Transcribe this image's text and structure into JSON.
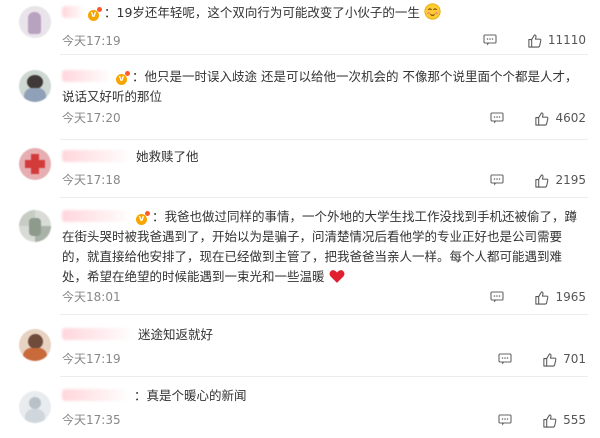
{
  "comments": [
    {
      "text": "19岁还年轻呢，这个双向行为可能改变了小伙子的一生",
      "time": "今天17:19",
      "likes": "11110"
    },
    {
      "text": "他只是一时误入歧途 还是可以给他一次机会的 不像那个说里面个个都是人才，说话又好听的那位",
      "time": "今天17:20",
      "likes": "4602"
    },
    {
      "text": "她救赎了他",
      "time": "今天17:18",
      "likes": "2195"
    },
    {
      "text": "我爸也做过同样的事情，一个外地的大学生找工作没找到手机还被偷了，蹲在街头哭时被我爸遇到了，开始以为是骗子，问清楚情况后看他学的专业正好也是公司需要的，就直接给他安排了，现在已经做到主管了，把我爸爸当亲人一样。每个人都可能遇到难处，希望在绝望的时候能遇到一束光和一些温暖",
      "time": "今天18:01",
      "likes": "1965"
    },
    {
      "text": "迷途知返就好",
      "time": "今天17:19",
      "likes": "701"
    },
    {
      "text": "真是个暖心的新闻",
      "time": "今天17:35",
      "likes": "555"
    }
  ],
  "colon": "："
}
